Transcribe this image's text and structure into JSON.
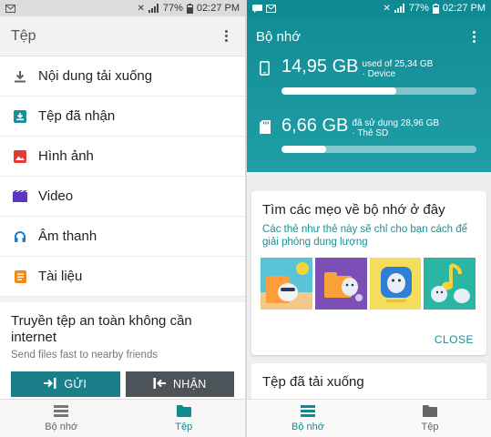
{
  "left": {
    "status": {
      "signal": "77%",
      "time": "02:27 PM"
    },
    "app_bar": {
      "title": "Tệp"
    },
    "menu": [
      {
        "label": "Nội dung tải xuống",
        "icon": "download-icon",
        "color": "#616161"
      },
      {
        "label": "Tệp đã nhận",
        "icon": "inbox-icon",
        "color": "#1b8e97"
      },
      {
        "label": "Hình ảnh",
        "icon": "image-icon",
        "color": "#e53935"
      },
      {
        "label": "Video",
        "icon": "video-icon",
        "color": "#5c35c4"
      },
      {
        "label": "Âm thanh",
        "icon": "headphones-icon",
        "color": "#1e7ad1"
      },
      {
        "label": "Tài liệu",
        "icon": "document-icon",
        "color": "#f08a1c"
      }
    ],
    "share": {
      "title": "Truyền tệp an toàn không cần internet",
      "subtitle": "Send files fast to nearby friends",
      "send_label": "GỬI",
      "receive_label": "NHẬN"
    },
    "bottom_nav": {
      "storage": "Bộ nhớ",
      "files": "Tệp",
      "active": "files"
    }
  },
  "right": {
    "status": {
      "signal": "77%",
      "time": "02:27 PM"
    },
    "app_bar": {
      "title": "Bộ nhớ"
    },
    "device": {
      "used": "14,95 GB",
      "detail1": "used of 25,34 GB",
      "detail2": "· Device",
      "fraction": 0.59
    },
    "sdcard": {
      "used": "6,66 GB",
      "detail1": "đã sử dụng 28,96 GB",
      "detail2": "· Thẻ SD",
      "fraction": 0.23
    },
    "tips": {
      "title": "Tìm các mẹo về bộ nhớ ở đây",
      "description": "Các thẻ như thẻ này sẽ chỉ cho bạn cách để giải phóng dung lượng",
      "close_label": "CLOSE"
    },
    "downloads": {
      "title": "Tệp đã tải xuống"
    },
    "bottom_nav": {
      "storage": "Bộ nhớ",
      "files": "Tệp",
      "active": "storage"
    }
  },
  "colors": {
    "accent": "#0f8a92",
    "accent_dark": "#1b7f8a",
    "receive_button": "#4d5459"
  }
}
